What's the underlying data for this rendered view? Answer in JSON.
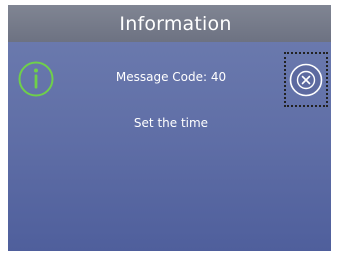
{
  "title_bar": {
    "title": "Information"
  },
  "info": {
    "icon": "info-icon",
    "icon_color": "#6fd04a"
  },
  "message": {
    "code_text": "Message Code: 40",
    "body_text": "Set the time"
  },
  "close": {
    "icon": "close-circle-icon"
  },
  "colors": {
    "screen_background": "#6272a8",
    "title_bar_background": "#7a7f8e",
    "text": "#ffffff"
  }
}
